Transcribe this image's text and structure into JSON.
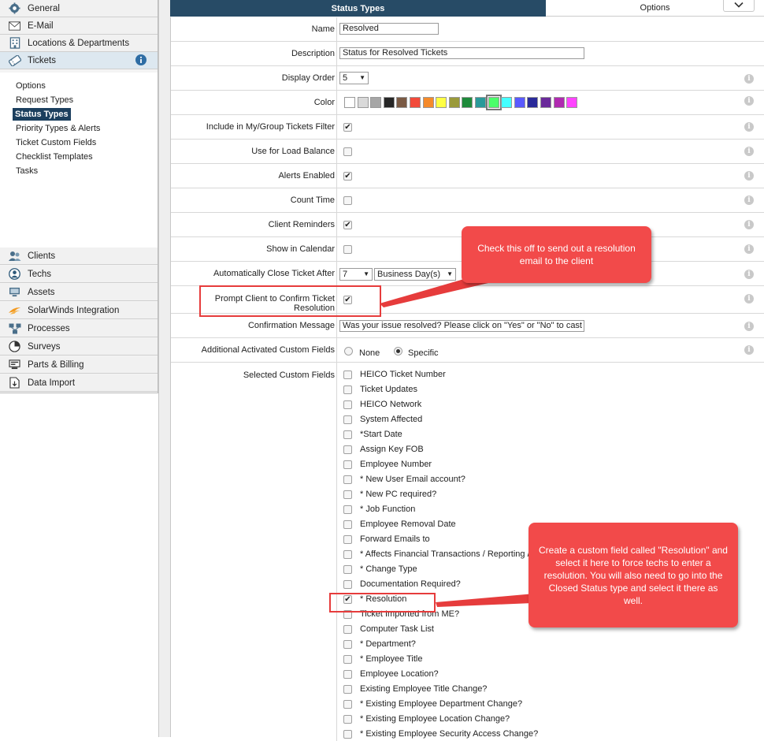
{
  "sidebar": {
    "top_items": [
      {
        "label": "General",
        "icon": "gear-icon"
      },
      {
        "label": "E-Mail",
        "icon": "envelope-icon"
      },
      {
        "label": "Locations & Departments",
        "icon": "building-icon"
      },
      {
        "label": "Tickets",
        "icon": "ticket-icon"
      }
    ],
    "submenu": [
      "Options",
      "Request Types",
      "Status Types",
      "Priority Types & Alerts",
      "Ticket Custom Fields",
      "Checklist Templates",
      "Tasks"
    ],
    "bottom_items": [
      {
        "label": "Clients",
        "icon": "users-icon"
      },
      {
        "label": "Techs",
        "icon": "tech-icon"
      },
      {
        "label": "Assets",
        "icon": "assets-icon"
      },
      {
        "label": "SolarWinds Integration",
        "icon": "solarwinds-icon"
      },
      {
        "label": "Processes",
        "icon": "processes-icon"
      },
      {
        "label": "Surveys",
        "icon": "pie-chart-icon"
      },
      {
        "label": "Parts & Billing",
        "icon": "billing-icon"
      },
      {
        "label": "Data Import",
        "icon": "import-icon"
      }
    ]
  },
  "tabs": {
    "status_types": "Status Types",
    "options": "Options"
  },
  "form": {
    "name_label": "Name",
    "name_value": "Resolved",
    "description_label": "Description",
    "description_value": "Status for Resolved Tickets",
    "display_order_label": "Display Order",
    "display_order_value": "5",
    "color_label": "Color",
    "colors": [
      "#ffffff",
      "#d9d9d9",
      "#a6a6a6",
      "#262626",
      "#7a5a44",
      "#f24a3a",
      "#f58a2a",
      "#ffff44",
      "#9a9a3a",
      "#1e8a3a",
      "#2a9a9a",
      "#4aff6a",
      "#44ffff",
      "#5a5aff",
      "#2a2a9a",
      "#6a2a9a",
      "#b02ab0",
      "#ff44ff"
    ],
    "selected_color_index": 11,
    "include_filter_label": "Include in My/Group Tickets Filter",
    "include_filter_checked": true,
    "load_balance_label": "Use for Load Balance",
    "load_balance_checked": false,
    "alerts_label": "Alerts Enabled",
    "alerts_checked": true,
    "count_time_label": "Count Time",
    "count_time_checked": false,
    "client_reminders_label": "Client Reminders",
    "client_reminders_checked": true,
    "show_calendar_label": "Show in Calendar",
    "show_calendar_checked": false,
    "auto_close_label": "Automatically Close Ticket After",
    "auto_close_value": "7",
    "auto_close_unit": "Business Day(s)",
    "prompt_confirm_label_line1": "Prompt Client to Confirm Ticket",
    "prompt_confirm_label_line2": "Resolution",
    "prompt_confirm_checked": true,
    "confirm_msg_label": "Confirmation Message",
    "confirm_msg_value": "Was your issue resolved? Please click on \"Yes\" or \"No\" to cast",
    "additional_cf_label": "Additional Activated Custom Fields",
    "radio_none": "None",
    "radio_specific": "Specific",
    "selected_cf_label": "Selected Custom Fields",
    "custom_fields": [
      {
        "label": "HEICO Ticket Number",
        "checked": false
      },
      {
        "label": "Ticket Updates",
        "checked": false
      },
      {
        "label": "HEICO Network",
        "checked": false
      },
      {
        "label": "System Affected",
        "checked": false
      },
      {
        "label": "*Start Date",
        "checked": false
      },
      {
        "label": "Assign Key FOB",
        "checked": false
      },
      {
        "label": "Employee Number",
        "checked": false
      },
      {
        "label": "* New User Email account?",
        "checked": false
      },
      {
        "label": "* New PC required?",
        "checked": false
      },
      {
        "label": "* Job Function",
        "checked": false
      },
      {
        "label": "Employee Removal Date",
        "checked": false
      },
      {
        "label": "Forward Emails to",
        "checked": false
      },
      {
        "label": "* Affects Financial Transactions / Reporting /",
        "checked": false
      },
      {
        "label": "* Change Type",
        "checked": false
      },
      {
        "label": "Documentation Required?",
        "checked": false
      },
      {
        "label": "* Resolution",
        "checked": true
      },
      {
        "label": "Ticket Imported from ME?",
        "checked": false
      },
      {
        "label": "Computer Task List",
        "checked": false
      },
      {
        "label": "* Department?",
        "checked": false
      },
      {
        "label": "* Employee Title",
        "checked": false
      },
      {
        "label": "Employee Location?",
        "checked": false
      },
      {
        "label": "Existing Employee Title Change?",
        "checked": false
      },
      {
        "label": "* Existing Employee Department Change?",
        "checked": false
      },
      {
        "label": "* Existing Employee Location Change?",
        "checked": false
      },
      {
        "label": "* Existing Employee Security Access Change?",
        "checked": false
      }
    ]
  },
  "annotations": {
    "callout_1": "Check this off to send out a resolution email to the client",
    "callout_2": "Create a custom field called \"Resolution\" and select it here to force techs to enter a resolution. You will also need to go into the Closed Status type and select it there as well.",
    "callout_color": "#f24a4a",
    "highlight_color": "#e63c3c"
  },
  "colors": {
    "tab_active_bg": "#274b66",
    "sidebar_selected_bg": "#1c3f5e",
    "info_icon": "#c9c9c9"
  }
}
